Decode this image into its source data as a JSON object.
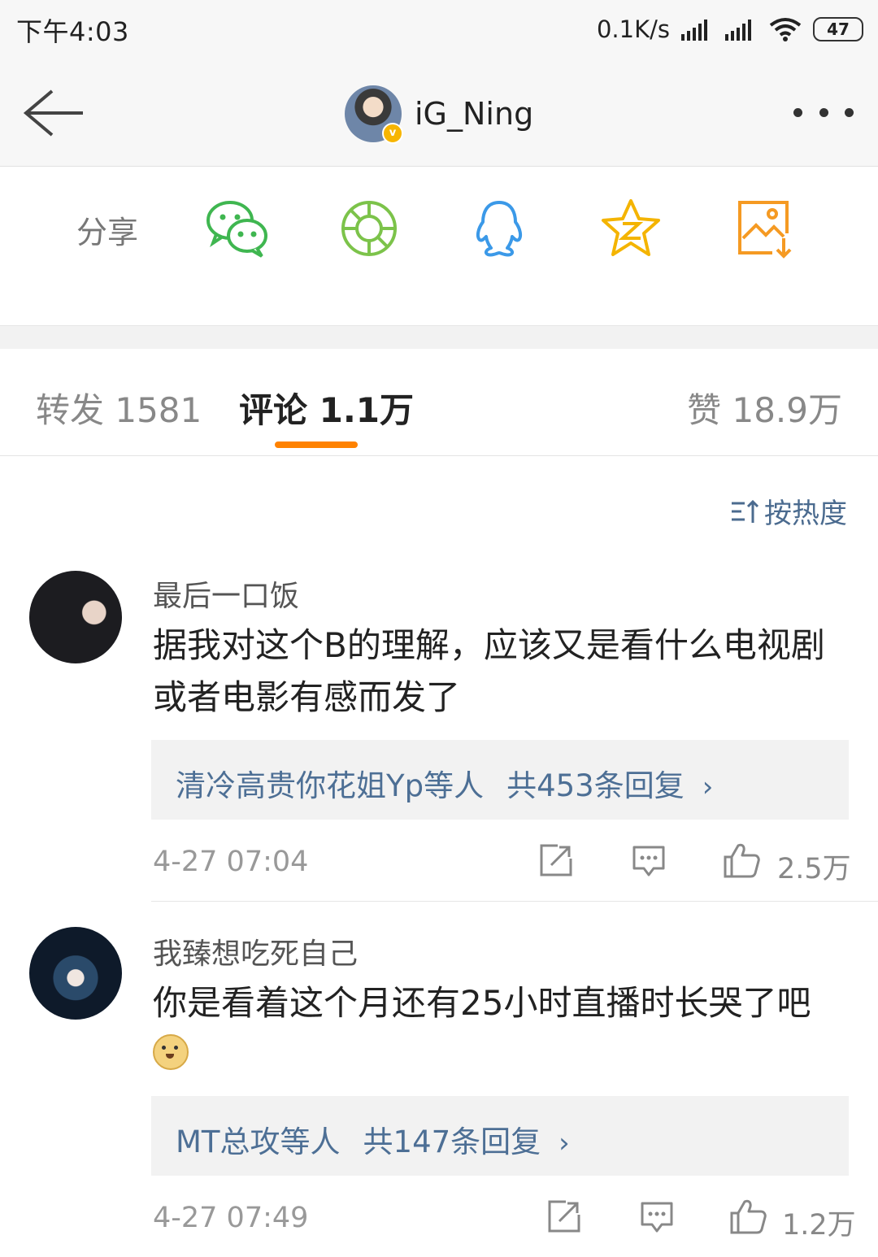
{
  "status_bar": {
    "time": "下午4:03",
    "net_speed": "0.1K/s",
    "battery": "47"
  },
  "header": {
    "username": "iG_Ning"
  },
  "share": {
    "label": "分享",
    "targets": [
      {
        "icon": "wechat-icon",
        "color": "#3fb650"
      },
      {
        "icon": "moments-icon",
        "color": "#7cc34a"
      },
      {
        "icon": "qq-icon",
        "color": "#3b99e8"
      },
      {
        "icon": "qzone-icon",
        "color": "#f4b400"
      },
      {
        "icon": "save-image-icon",
        "color": "#f59a23"
      }
    ]
  },
  "tabs": {
    "reposts": "转发 1581",
    "comments": "评论 1.1万",
    "likes": "赞 18.9万"
  },
  "sort_label": "按热度",
  "colors": {
    "accent": "#ff8200",
    "link": "#4d6f95"
  },
  "comments": [
    {
      "username": "最后一口饭",
      "text": "据我对这个B的理解，应该又是看什么电视剧或者电影有感而发了",
      "reply_names": "清冷高贵你花姐Yp等人",
      "reply_count": "共453条回复",
      "time": "4-27 07:04",
      "likes": "2.5万"
    },
    {
      "username": "我臻想吃死自己",
      "text": "你是看着这个月还有25小时直播时长哭了吧",
      "reply_names": "MT总攻等人",
      "reply_count": "共147条回复",
      "time": "4-27 07:49",
      "likes": "1.2万"
    }
  ]
}
